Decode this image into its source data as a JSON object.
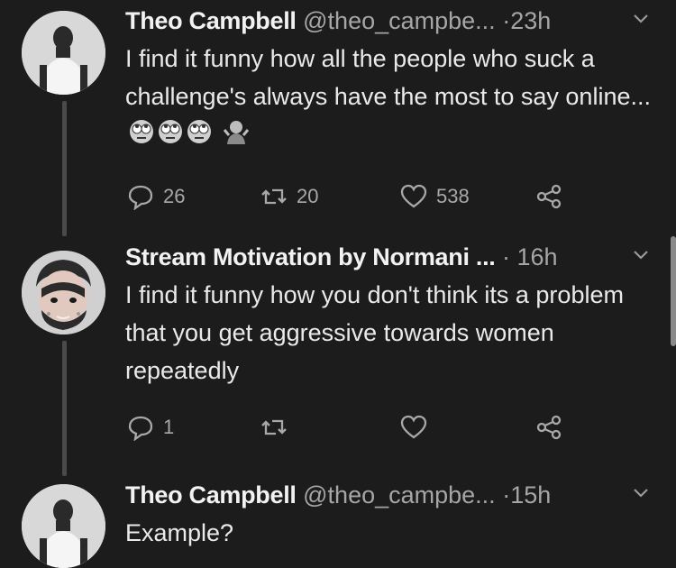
{
  "tweets": [
    {
      "name": "Theo Campbell",
      "handle": "@theo_campbe...",
      "time": "23h",
      "text": "I find it funny how all the people who suck a challenge's always have the most to say online...",
      "emojis": [
        "eye-roll-emoji",
        "eye-roll-emoji",
        "eye-roll-emoji",
        "shrug-emoji"
      ],
      "replies": "26",
      "retweets": "20",
      "likes": "538"
    },
    {
      "name": "Stream Motivation by Normani ...",
      "handle": "",
      "time": "16h",
      "text": "I find it funny how you don't think its a problem that you get aggressive towards women repeatedly",
      "replies": "1",
      "retweets": "",
      "likes": ""
    },
    {
      "name": "Theo Campbell",
      "handle": "@theo_campbe...",
      "time": "15h",
      "text": "Example?"
    }
  ],
  "separator": "·",
  "icons": {
    "reply": "reply-icon",
    "retweet": "retweet-icon",
    "like": "heart-icon",
    "share": "share-icon",
    "menu": "chevron-down-icon"
  },
  "colors": {
    "background": "#1c1c1c",
    "text": "#eaeaea",
    "secondary": "#a6a6a6",
    "thread_line": "#4a4a4a"
  }
}
